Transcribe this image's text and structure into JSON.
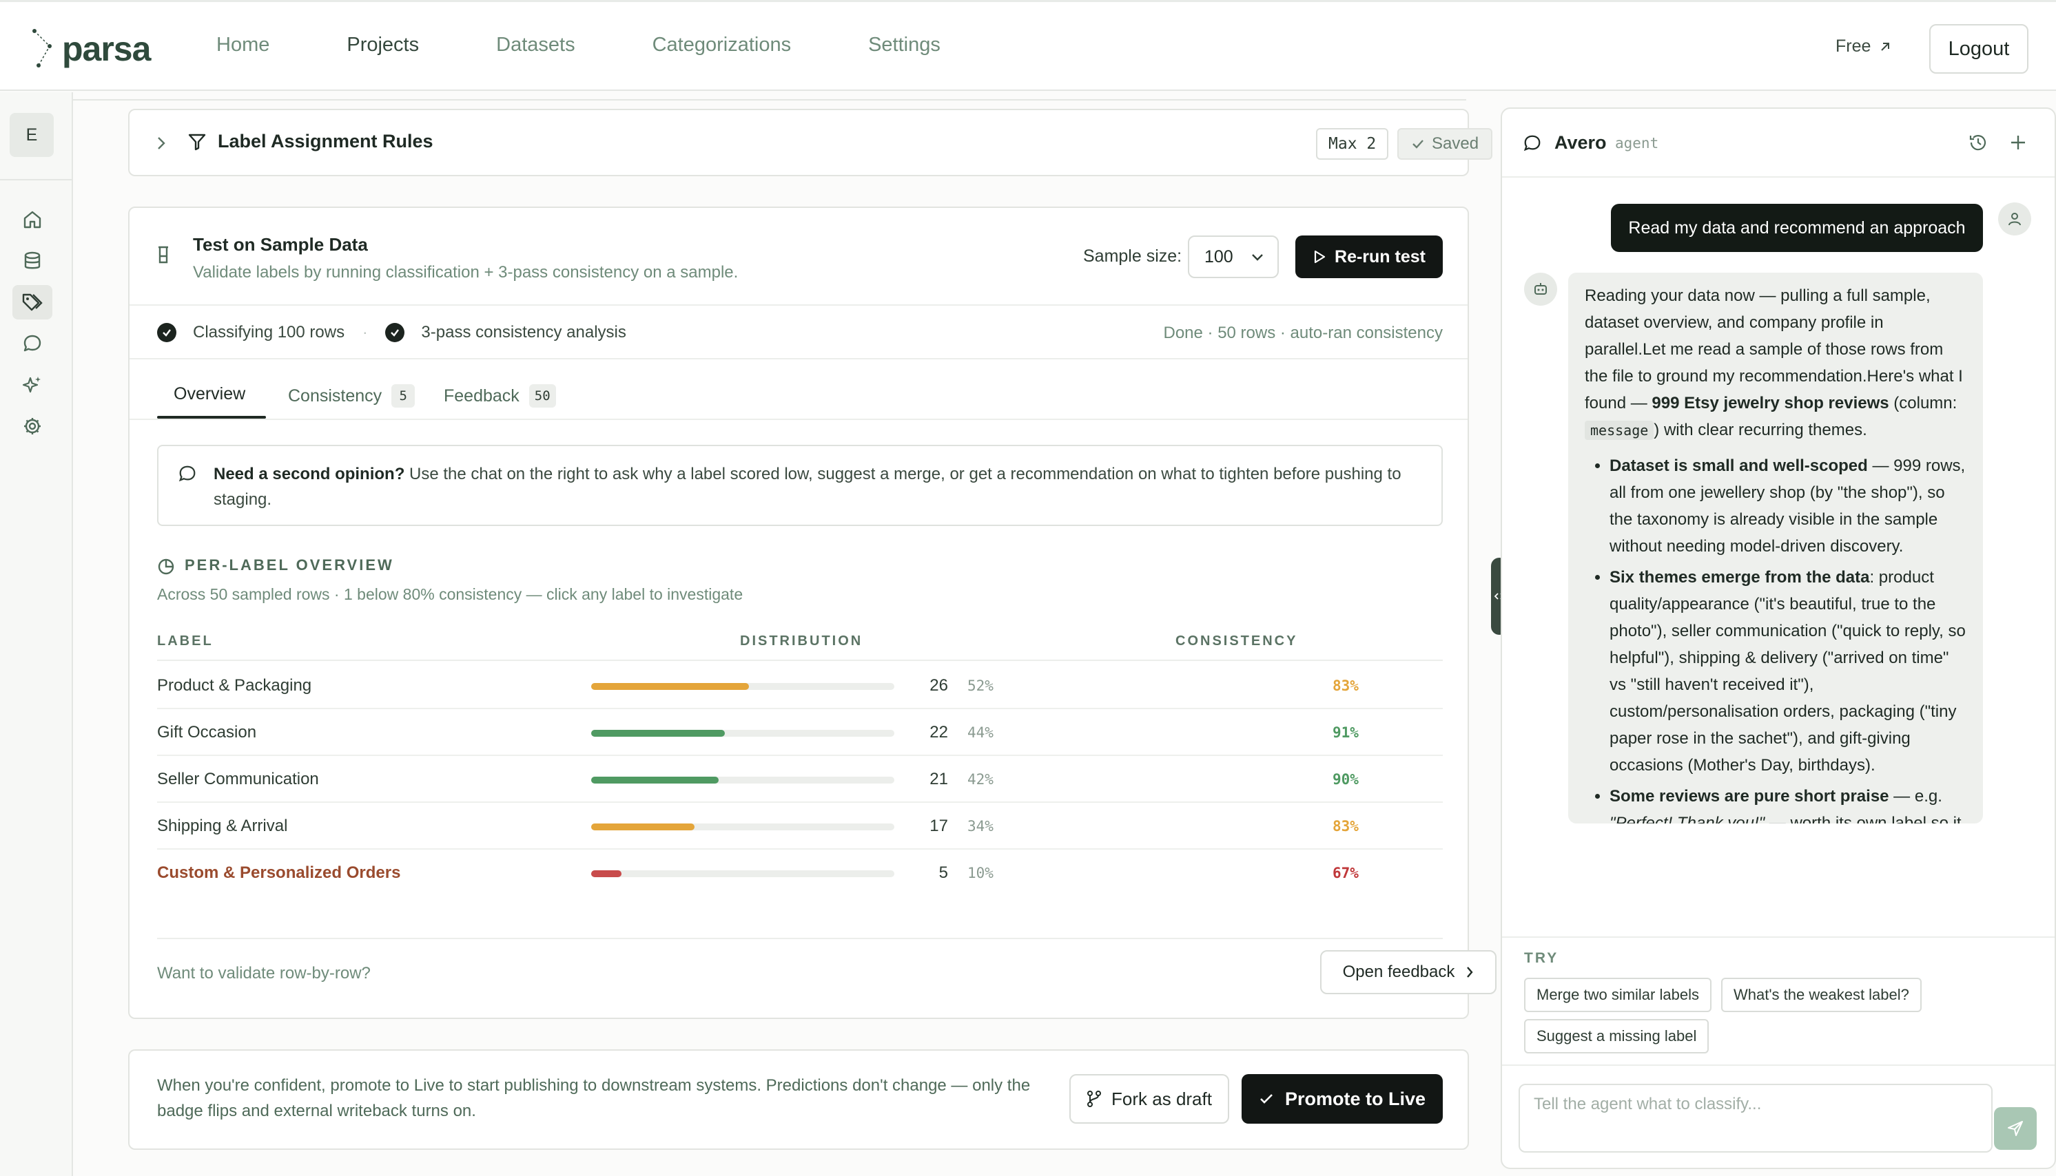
{
  "app": {
    "name": "parsa"
  },
  "nav": {
    "items": [
      "Home",
      "Projects",
      "Datasets",
      "Categorizations",
      "Settings"
    ],
    "active": "Projects",
    "free_label": "Free",
    "logout_label": "Logout"
  },
  "rail": {
    "avatar_letter": "E"
  },
  "rules": {
    "title": "Label Assignment Rules",
    "max_badge": "Max 2",
    "saved_label": "Saved"
  },
  "test": {
    "title": "Test on Sample Data",
    "subtitle": "Validate labels by running classification + 3-pass consistency on a sample.",
    "sample_size_label": "Sample size:",
    "sample_size_value": "100",
    "rerun_label": "Re-run test",
    "status": {
      "step1": "Classifying 100 rows",
      "step2": "3-pass consistency analysis",
      "summary": "Done · 50 rows · auto-ran consistency"
    },
    "tabs": [
      {
        "label": "Overview",
        "count": ""
      },
      {
        "label": "Consistency",
        "count": "5"
      },
      {
        "label": "Feedback",
        "count": "50"
      }
    ],
    "opinion": {
      "bold": "Need a second opinion?",
      "text": " Use the chat on the right to ask why a label scored low, suggest a merge, or get a recommendation on what to tighten before pushing to staging."
    },
    "overview": {
      "title": "PER-LABEL OVERVIEW",
      "subtitle": "Across 50 sampled rows · 1 below 80% consistency — click any label to investigate",
      "columns": {
        "label": "LABEL",
        "distribution": "DISTRIBUTION",
        "consistency": "CONSISTENCY"
      },
      "rows": [
        {
          "label": "Product & Packaging",
          "count": "26",
          "pct": "52%",
          "fraction": 0.52,
          "consistency": "83%",
          "bar_color": "#e4a53a",
          "cons_color": "#e4a53a",
          "warn": false
        },
        {
          "label": "Gift Occasion",
          "count": "22",
          "pct": "44%",
          "fraction": 0.44,
          "consistency": "91%",
          "bar_color": "#4f9a62",
          "cons_color": "#4f9a62",
          "warn": false
        },
        {
          "label": "Seller Communication",
          "count": "21",
          "pct": "42%",
          "fraction": 0.42,
          "consistency": "90%",
          "bar_color": "#4f9a62",
          "cons_color": "#4f9a62",
          "warn": false
        },
        {
          "label": "Shipping & Arrival",
          "count": "17",
          "pct": "34%",
          "fraction": 0.34,
          "consistency": "83%",
          "bar_color": "#e4a53a",
          "cons_color": "#e4a53a",
          "warn": false
        },
        {
          "label": "Custom & Personalized Orders",
          "count": "5",
          "pct": "10%",
          "fraction": 0.1,
          "consistency": "67%",
          "bar_color": "#c84b4b",
          "cons_color": "#c0383a",
          "warn": true
        }
      ]
    },
    "validate_text": "Want to validate row-by-row?",
    "open_feedback_label": "Open feedback"
  },
  "promote": {
    "text": "When you're confident, promote to Live to start publishing to downstream systems. Predictions don't change — only the badge flips and external writeback turns on.",
    "fork_label": "Fork as draft",
    "promote_label": "Promote to Live"
  },
  "agent": {
    "name": "Avero",
    "tag": "agent",
    "user_message": "Read my data and recommend an approach",
    "reply": {
      "p1_before": "Reading your data now — pulling a full sample, dataset overview, and company profile in parallel.Let me read a sample of those rows from the file to ground my recommendation.Here's what I found — ",
      "p1_bold": "999 Etsy jewelry shop reviews",
      "p1_after1": " (column: ",
      "p1_code": "message",
      "p1_after2": ") with clear recurring themes.",
      "b1_bold": "Dataset is small and well-scoped",
      "b1_text": " — 999 rows, all from one jewellery shop (by \"the shop\"), so the taxonomy is already visible in the sample without needing model-driven discovery.",
      "b2_bold": "Six themes emerge from the data",
      "b2_text": ": product quality/appearance (\"it's beautiful, true to the photo\"), seller communication (\"quick to reply, so helpful\"), shipping & delivery (\"arrived on time\" vs \"still haven't received it\"), custom/personalisation orders, packaging (\"tiny paper rose in the sachet\"), and gift-giving occasions (Mother's Day, birthdays).",
      "b3_bold": "Some reviews are pure short praise",
      "b3_text1": " — e.g. ",
      "b3_italic": "\"Perfect! Thank you!\"",
      "b3_text2": " — worth its own label so it doesn't dilute the signal in the more"
    },
    "try_label": "TRY",
    "suggestions": [
      "Merge two similar labels",
      "What's the weakest label?",
      "Suggest a missing label"
    ],
    "input_placeholder": "Tell the agent what to classify..."
  },
  "colors": {
    "primary_dark": "#121614",
    "brand": "#2f4a3c",
    "amber": "#e4a53a",
    "green": "#4f9a62",
    "red": "#c0383a"
  }
}
